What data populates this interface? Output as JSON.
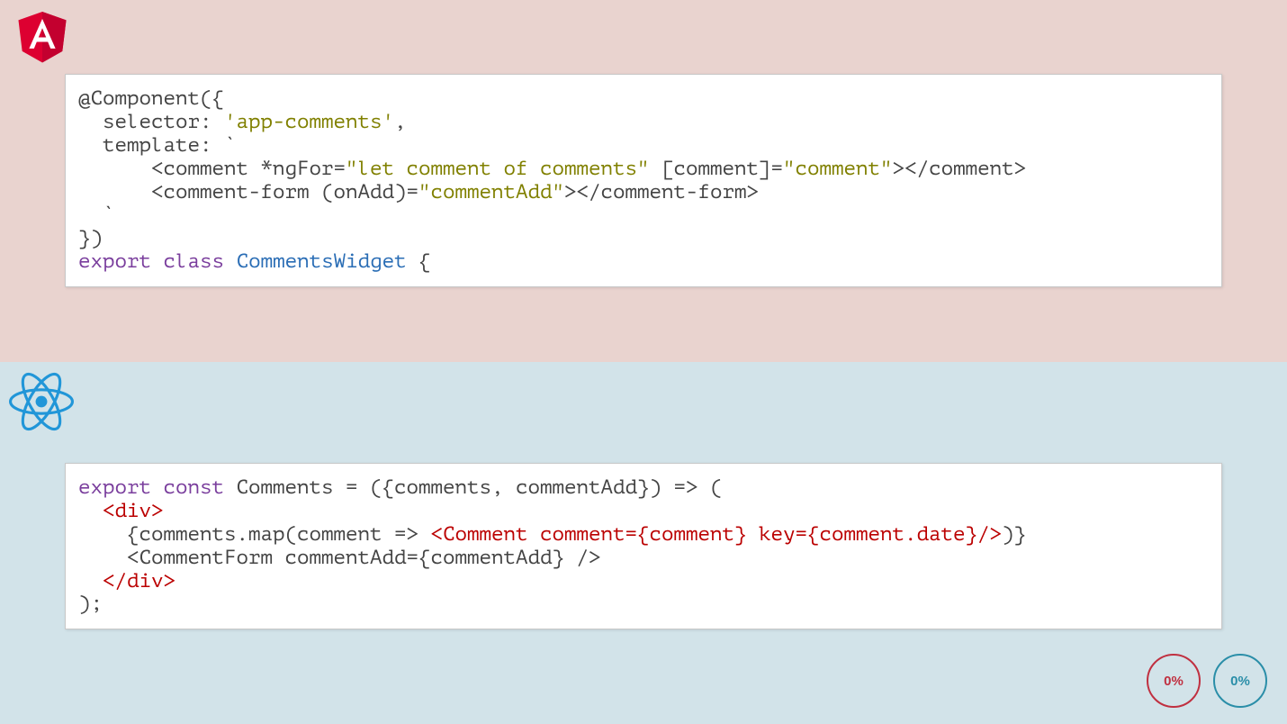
{
  "angular": {
    "tokens": [
      {
        "cls": "t-default",
        "text": "@Component({\n  selector: "
      },
      {
        "cls": "t-string",
        "text": "'app-comments'"
      },
      {
        "cls": "t-default",
        "text": ",\n  template: `\n      <comment *ngFor="
      },
      {
        "cls": "t-string",
        "text": "\"let comment of comments\""
      },
      {
        "cls": "t-default",
        "text": " [comment]="
      },
      {
        "cls": "t-string",
        "text": "\"comment\""
      },
      {
        "cls": "t-default",
        "text": "></comment>\n      <comment-form (onAdd)="
      },
      {
        "cls": "t-string",
        "text": "\"commentAdd\""
      },
      {
        "cls": "t-default",
        "text": "></comment-form>\n  `\n})\n"
      },
      {
        "cls": "t-keyword",
        "text": "export"
      },
      {
        "cls": "t-default",
        "text": " "
      },
      {
        "cls": "t-keyword",
        "text": "class"
      },
      {
        "cls": "t-default",
        "text": " "
      },
      {
        "cls": "t-type",
        "text": "CommentsWidget"
      },
      {
        "cls": "t-default",
        "text": " {"
      }
    ]
  },
  "react": {
    "tokens": [
      {
        "cls": "t-keyword",
        "text": "export"
      },
      {
        "cls": "t-default",
        "text": " "
      },
      {
        "cls": "t-keyword",
        "text": "const"
      },
      {
        "cls": "t-default",
        "text": " Comments = ({comments, commentAdd}) => (\n  "
      },
      {
        "cls": "t-tag",
        "text": "<div>"
      },
      {
        "cls": "t-default",
        "text": "\n    {comments.map(comment => "
      },
      {
        "cls": "t-tag",
        "text": "<Comment comment={comment} key={comment.date}/>"
      },
      {
        "cls": "t-default",
        "text": ")}\n    <CommentForm commentAdd={commentAdd} />\n  "
      },
      {
        "cls": "t-tag",
        "text": "</div>"
      },
      {
        "cls": "t-default",
        "text": "\n);"
      }
    ]
  },
  "badges": {
    "red": "0%",
    "blue": "0%"
  }
}
